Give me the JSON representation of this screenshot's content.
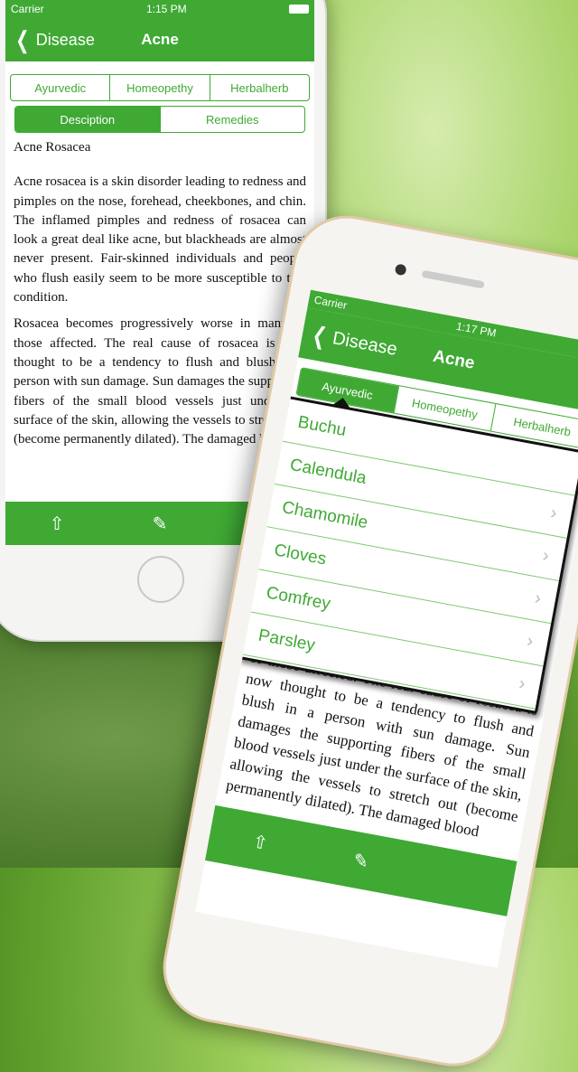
{
  "colors": {
    "accent": "#3fa934"
  },
  "phone1": {
    "status": {
      "carrier": "Carrier",
      "time": "1:15 PM"
    },
    "nav": {
      "back_label": "Disease",
      "title": "Acne"
    },
    "tabs": [
      "Ayurvedic",
      "Homeopethy",
      "Herbalherb"
    ],
    "subtabs": [
      "Desciption",
      "Remedies"
    ],
    "heading": "Acne Rosacea",
    "paragraphs": [
      "Acne rosacea is a skin disorder leading to redness and pimples on the nose, forehead, cheekbones, and chin. The inflamed pimples and redness of rosacea can look a great deal like acne, but blackheads are almost never present. Fair-skinned individuals and people who flush easily seem to be more susceptible to this condition.",
      "Rosacea becomes progressively worse in many of those affected. The real cause of rosacea is now thought to be a tendency to flush and blush in a person with sun damage. Sun damages the supporting fibers of the small blood vessels just under the surface of the skin, allowing the vessels to stretch out (become permanently dilated). The damaged blood"
    ],
    "toolbar": {
      "share_icon": "share-icon",
      "edit_icon": "edit-icon"
    }
  },
  "phone2": {
    "status": {
      "carrier": "Carrier",
      "time": "1:17 PM"
    },
    "nav": {
      "back_label": "Disease",
      "title": "Acne"
    },
    "tabs": [
      "Ayurvedic",
      "Homeopethy",
      "Herbalherb"
    ],
    "remedies": [
      "Buchu",
      "Calendula",
      "Chamomile",
      "Cloves",
      "Comfrey",
      "Parsley",
      ""
    ],
    "paragraph": "of those affected. The real cause of rosacea is now thought to be a tendency to flush and blush in a person with sun damage. Sun damages the supporting fibers of the small blood vessels just under the surface of the skin, allowing the vessels to stretch out (become permanently dilated). The damaged blood"
  }
}
